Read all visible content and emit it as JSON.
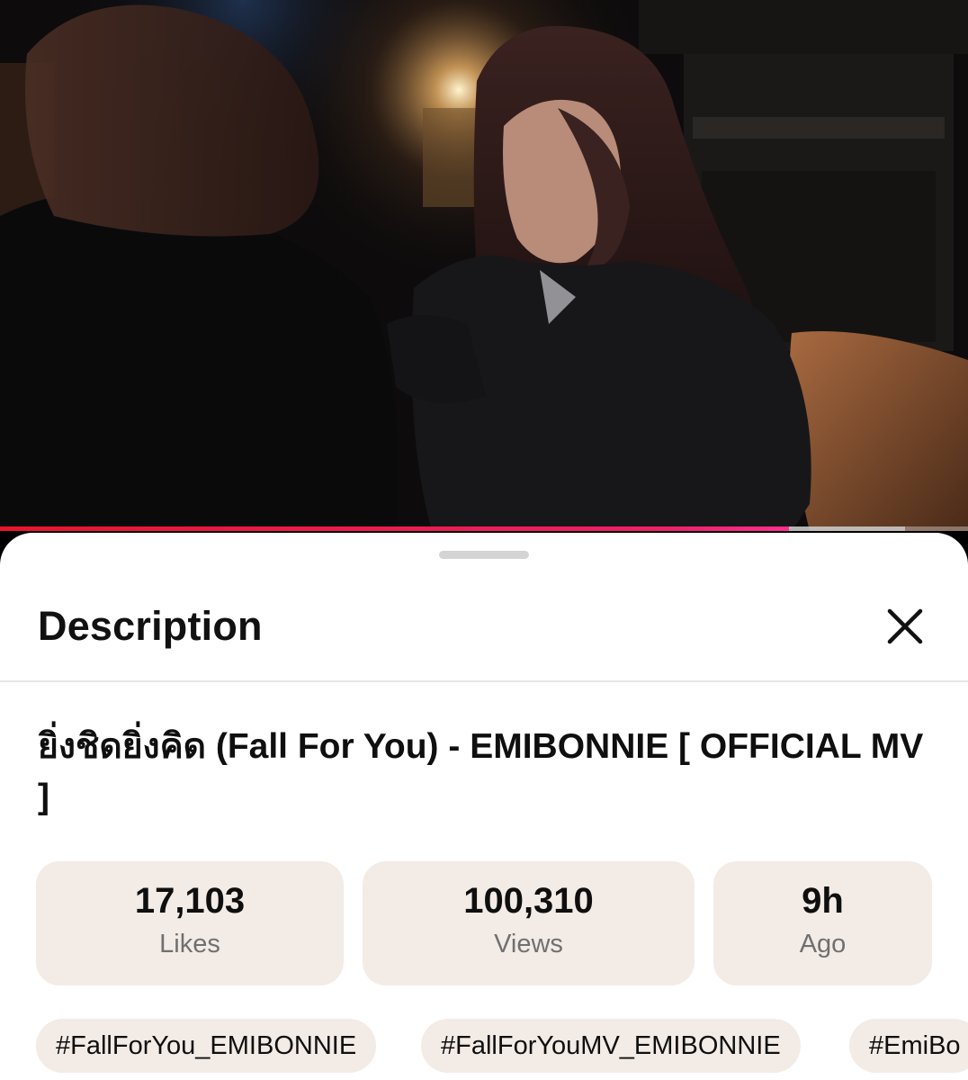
{
  "player": {
    "progress_fraction": 0.815,
    "buffer_fraction": 0.935,
    "progress_color": "#e8152a"
  },
  "description_panel": {
    "title": "Description",
    "close_icon": "close-icon",
    "video_title": "ยิ่งชิดยิ่งคิด (Fall For You) - EMIBONNIE [ OFFICIAL MV ]",
    "stats": [
      {
        "value": "17,103",
        "label": "Likes"
      },
      {
        "value": "100,310",
        "label": "Views"
      },
      {
        "value": "9h",
        "label": "Ago"
      }
    ],
    "hashtags": [
      "#FallForYou_EMIBONNIE",
      "#FallForYouMV_EMIBONNIE",
      "#EmiBo"
    ],
    "chip_color": "#f3ebe6"
  }
}
